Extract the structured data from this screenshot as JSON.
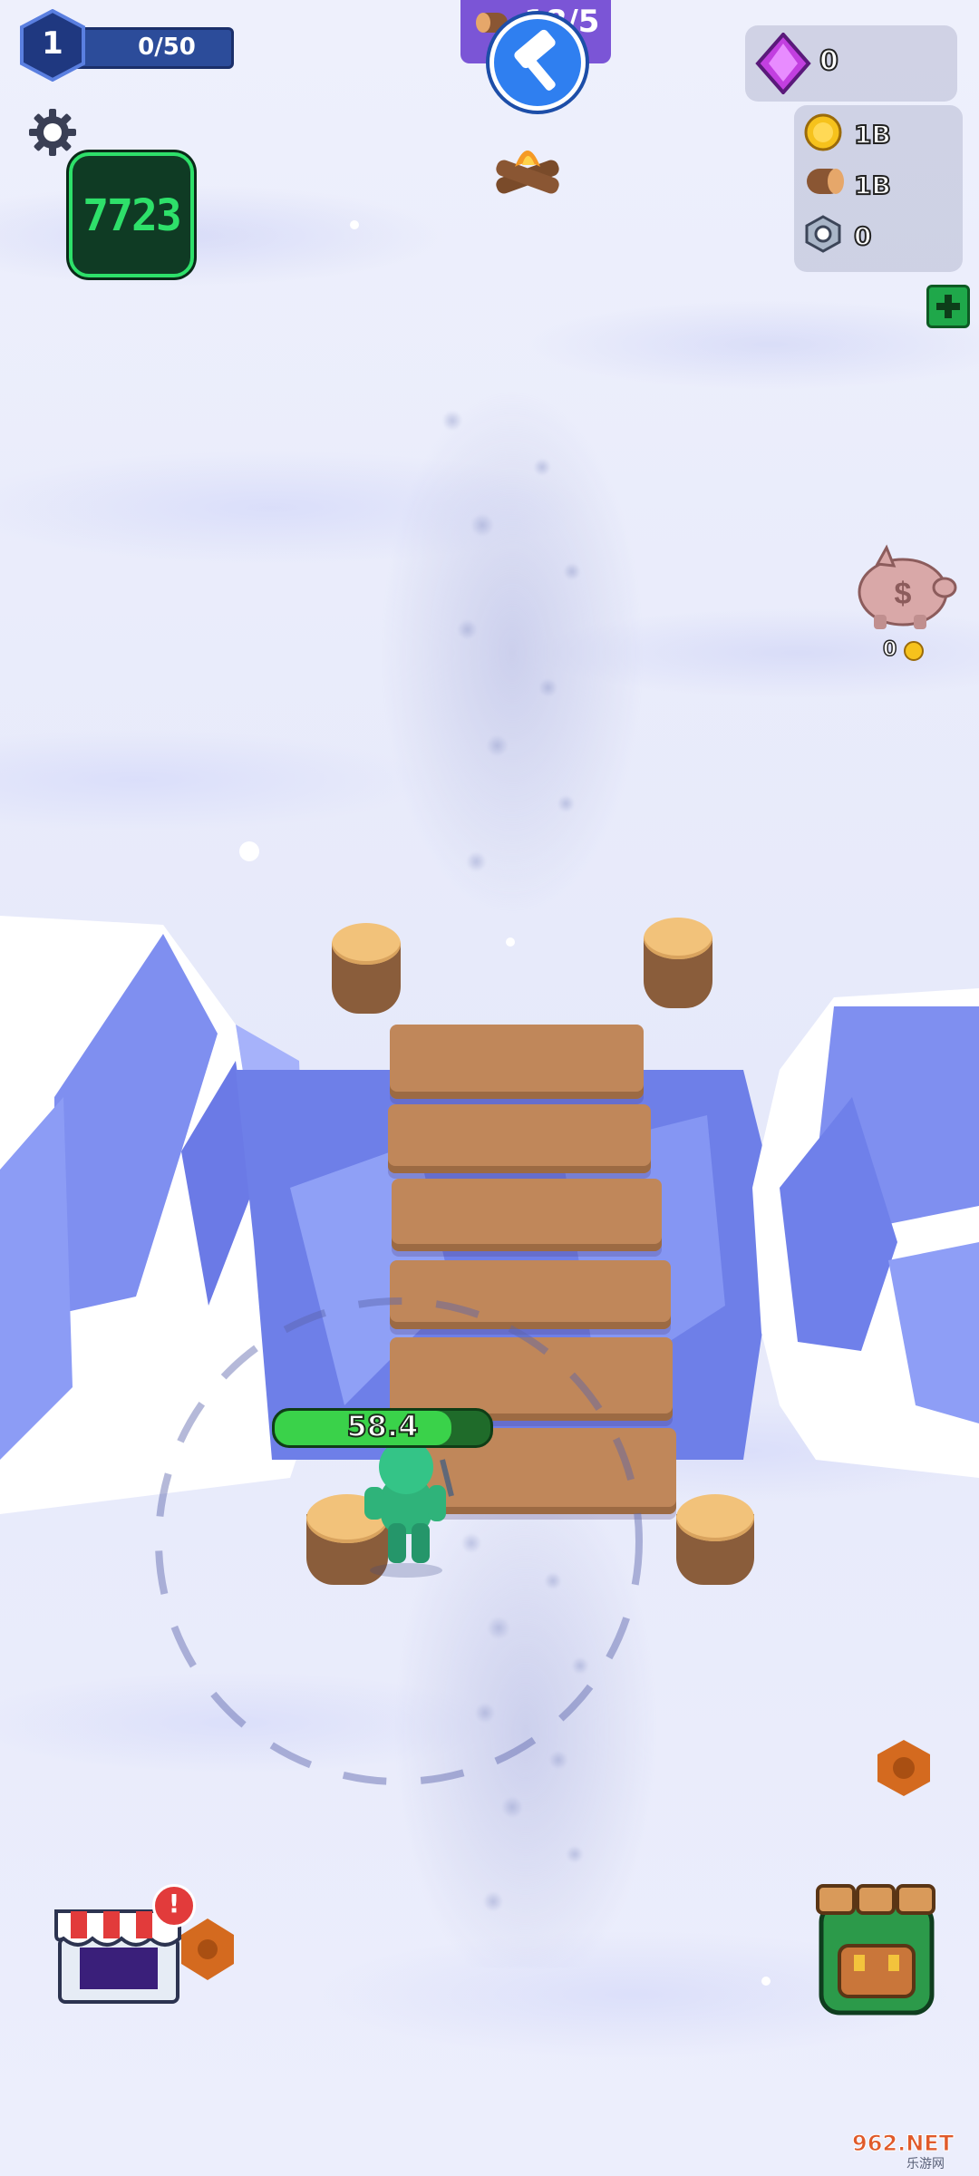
{
  "player": {
    "level": "1",
    "xp_text": "0/50"
  },
  "timer_badge": {
    "value": "7723"
  },
  "build_task": {
    "progress_text": "18/5"
  },
  "currencies": {
    "gems": "0",
    "gold": "1B",
    "wood": "1B",
    "nuts": "0"
  },
  "piggy_bank": {
    "value": "0"
  },
  "character": {
    "health": "58.4",
    "health_fraction": 0.82
  },
  "shop": {
    "alert": "!"
  },
  "watermark": {
    "text": "962.NET",
    "subtext": "乐游网"
  },
  "colors": {
    "snow": "#e9ecfb",
    "ice": "#7f8ff0",
    "wood": "#c0875a",
    "health": "#3ad24a",
    "timer_bg": "#0f3b24",
    "timer_text": "#2ee06a",
    "hud_blue": "#2c4c9a",
    "build_purple": "#7b55d6"
  },
  "icons": {
    "settings": "gear-icon",
    "hammer": "hammer-icon",
    "gem": "gem-icon",
    "gold": "coin-icon",
    "wood": "log-icon",
    "nuts": "nut-icon",
    "add": "plus-icon",
    "piggy": "piggy-bank-icon",
    "shop": "shop-icon",
    "backpack": "backpack-icon",
    "campfire": "campfire-icon"
  }
}
